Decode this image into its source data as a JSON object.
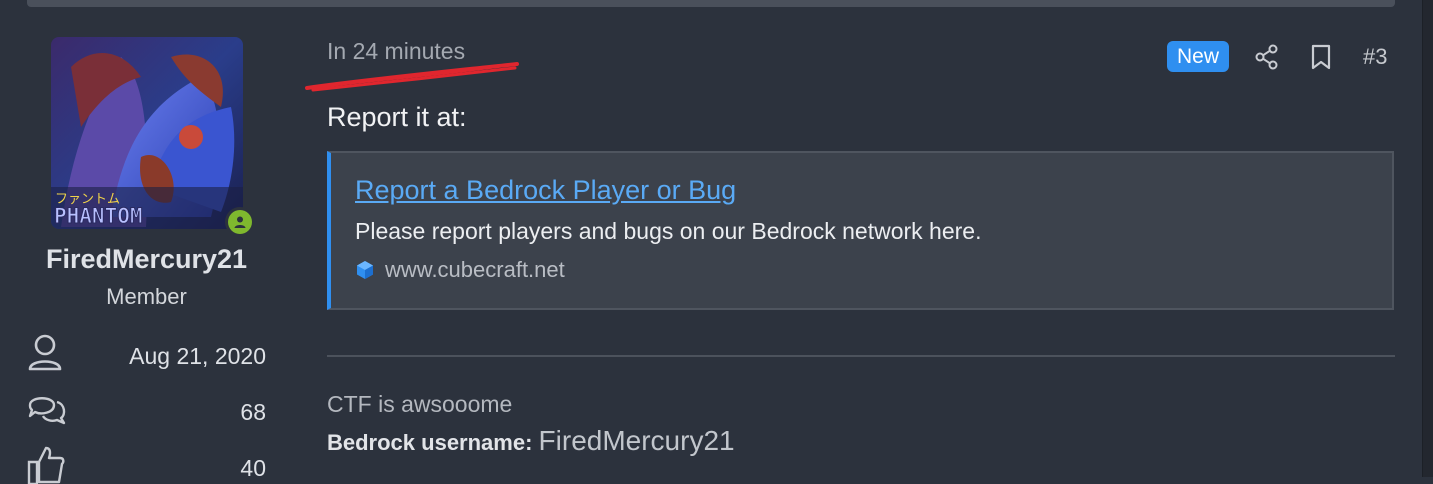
{
  "author": {
    "username": "FiredMercury21",
    "role": "Member",
    "avatar_text_top": "ファントム",
    "avatar_text": "PHANTOM",
    "joined": "Aug 21, 2020",
    "messages": "68",
    "reactions": "40"
  },
  "post": {
    "time": "In 24 minutes",
    "new_badge": "New",
    "post_number": "#3",
    "body_text": "Report it at:",
    "unfurl": {
      "title": "Report a Bedrock Player or Bug",
      "description": "Please report players and bugs on our Bedrock network here.",
      "domain": "www.cubecraft.net"
    }
  },
  "signature": {
    "line1": "CTF is awsooome",
    "label": "Bedrock username:",
    "value": "FiredMercury21"
  },
  "colors": {
    "background": "#2c323d",
    "accent": "#2f8ff0",
    "link": "#5aaaf5",
    "online": "#7fb82e",
    "scribble": "#e0262e"
  },
  "icons": [
    "user-icon",
    "comments-icon",
    "thumbs-up-icon",
    "share-icon",
    "bookmark-icon",
    "cube-icon",
    "online-icon"
  ]
}
